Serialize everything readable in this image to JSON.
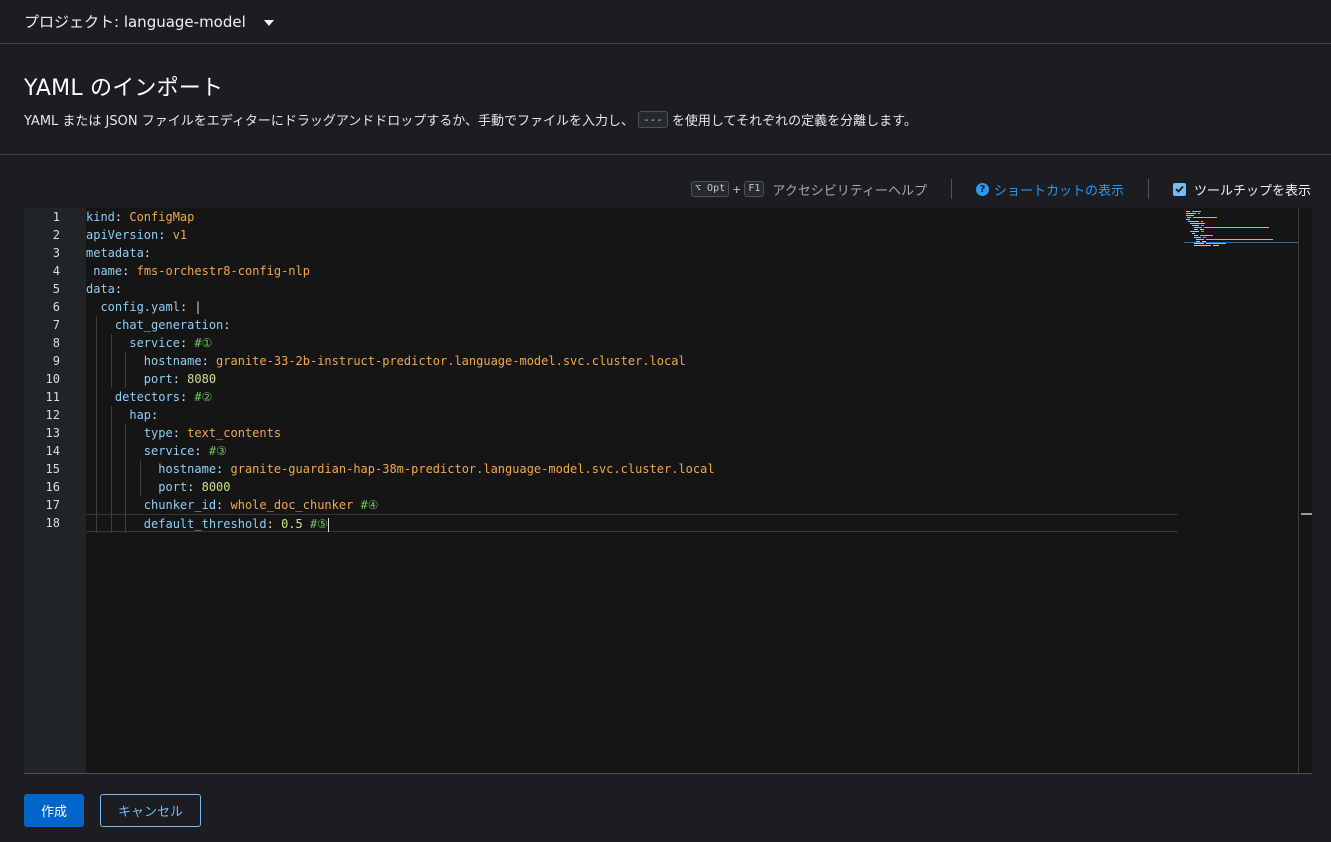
{
  "project": {
    "label": "プロジェクト: language-model",
    "icon": "caret-down-icon"
  },
  "page": {
    "title": "YAML のインポート",
    "description_before": "YAML または JSON ファイルをエディターにドラッグアンドドロップするか、手動でファイルを入力し、",
    "description_code": "---",
    "description_after": "を使用してそれぞれの定義を分離します。"
  },
  "toolbar": {
    "key_modifier": "⌥ Opt",
    "key_plus": "+",
    "key_f1": "F1",
    "accessibility_help": "アクセシビリティーヘルプ",
    "shortcuts_link": "ショートカットの表示",
    "show_tooltips_label": "ツールチップを表示",
    "show_tooltips_checked": true
  },
  "editor": {
    "line_numbers": [
      "1",
      "2",
      "3",
      "4",
      "5",
      "6",
      "7",
      "8",
      "9",
      "10",
      "11",
      "12",
      "13",
      "14",
      "15",
      "16",
      "17",
      "18"
    ],
    "lines": [
      {
        "indent": "",
        "key": "kind",
        "colon": ": ",
        "value": "ConfigMap",
        "comment": ""
      },
      {
        "indent": "",
        "key": "apiVersion",
        "colon": ": ",
        "value": "v1",
        "comment": ""
      },
      {
        "indent": "",
        "key": "metadata",
        "colon": ":",
        "value": "",
        "comment": ""
      },
      {
        "indent": " ",
        "key": "name",
        "colon": ": ",
        "value": "fms-orchestr8-config-nlp",
        "comment": ""
      },
      {
        "indent": "",
        "key": "data",
        "colon": ":",
        "value": "",
        "comment": ""
      },
      {
        "indent": "  ",
        "key": "config.yaml",
        "colon": ": ",
        "value": "|",
        "comment": ""
      },
      {
        "indent": "    ",
        "key": "chat_generation",
        "colon": ":",
        "value": "",
        "comment": ""
      },
      {
        "indent": "      ",
        "key": "service",
        "colon": ": ",
        "value": "",
        "comment": "#①"
      },
      {
        "indent": "        ",
        "key": "hostname",
        "colon": ": ",
        "value": "granite-33-2b-instruct-predictor.language-model.svc.cluster.local",
        "comment": ""
      },
      {
        "indent": "        ",
        "key": "port",
        "colon": ": ",
        "value": "8080",
        "comment": ""
      },
      {
        "indent": "    ",
        "key": "detectors",
        "colon": ": ",
        "value": "",
        "comment": "#②"
      },
      {
        "indent": "      ",
        "key": "hap",
        "colon": ":",
        "value": "",
        "comment": ""
      },
      {
        "indent": "        ",
        "key": "type",
        "colon": ": ",
        "value": "text_contents",
        "comment": ""
      },
      {
        "indent": "        ",
        "key": "service",
        "colon": ": ",
        "value": "",
        "comment": "#③"
      },
      {
        "indent": "          ",
        "key": "hostname",
        "colon": ": ",
        "value": "granite-guardian-hap-38m-predictor.language-model.svc.cluster.local",
        "comment": ""
      },
      {
        "indent": "          ",
        "key": "port",
        "colon": ": ",
        "value": "8000",
        "comment": ""
      },
      {
        "indent": "        ",
        "key": "chunker_id",
        "colon": ": ",
        "value": "whole_doc_chunker",
        "comment": "#④"
      },
      {
        "indent": "        ",
        "key": "default_threshold",
        "colon": ": ",
        "value": "0.5",
        "comment": "#⑤"
      }
    ],
    "colors": {
      "key": "#8ad0f7",
      "string": "#f5a742",
      "number": "#c5e48a",
      "comment": "#6ec461"
    }
  },
  "actions": {
    "create": "作成",
    "cancel": "キャンセル"
  }
}
